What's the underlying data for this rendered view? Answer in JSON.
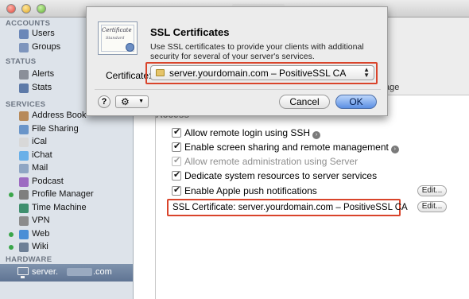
{
  "window": {
    "title_prefix": "server.",
    "title_suffix": ".com"
  },
  "sidebar": {
    "accounts_header": "ACCOUNTS",
    "accounts": [
      {
        "label": "Users",
        "icon": "users-icon"
      },
      {
        "label": "Groups",
        "icon": "groups-icon"
      }
    ],
    "status_header": "STATUS",
    "status": [
      {
        "label": "Alerts",
        "icon": "alerts-icon"
      },
      {
        "label": "Stats",
        "icon": "stats-icon"
      }
    ],
    "services_header": "SERVICES",
    "services": [
      {
        "label": "Address Book",
        "icon": "address-book-icon"
      },
      {
        "label": "File Sharing",
        "icon": "file-sharing-icon"
      },
      {
        "label": "iCal",
        "icon": "ical-icon"
      },
      {
        "label": "iChat",
        "icon": "ichat-icon"
      },
      {
        "label": "Mail",
        "icon": "mail-icon"
      },
      {
        "label": "Podcast",
        "icon": "podcast-icon"
      },
      {
        "label": "Profile Manager",
        "icon": "profile-manager-icon",
        "active": true
      },
      {
        "label": "Time Machine",
        "icon": "time-machine-icon"
      },
      {
        "label": "VPN",
        "icon": "vpn-icon"
      },
      {
        "label": "Web",
        "icon": "web-icon",
        "active": true
      },
      {
        "label": "Wiki",
        "icon": "wiki-icon",
        "active": true
      }
    ],
    "hardware_header": "HARDWARE",
    "hardware_item": {
      "prefix": "server.",
      "suffix": ".com"
    }
  },
  "main": {
    "tab_fragment": "age",
    "section_header": "Access",
    "rows": [
      {
        "label": "Allow remote login using SSH",
        "checked": true,
        "arrow": true
      },
      {
        "label": "Enable screen sharing and remote management",
        "checked": true,
        "arrow": true
      },
      {
        "label": "Allow remote administration using Server",
        "checked": true,
        "disabled": true
      },
      {
        "label": "Dedicate system resources to server services",
        "checked": true
      },
      {
        "label": "Enable Apple push notifications",
        "checked": true
      }
    ],
    "edit_label": "Edit...",
    "ssl_line": "SSL Certificate:  server.yourdomain.com – PositiveSSL CA"
  },
  "sheet": {
    "cert_title": "Certificate",
    "cert_subtitle": "Standard",
    "title": "SSL Certificates",
    "description": "Use SSL certificates to provide your clients with additional security for several of your server's services.",
    "certificate_label": "Certificate:",
    "certificate_value": "server.yourdomain.com  – PositiveSSL CA",
    "help": "?",
    "gear": "⚙",
    "cancel": "Cancel",
    "ok": "OK"
  }
}
